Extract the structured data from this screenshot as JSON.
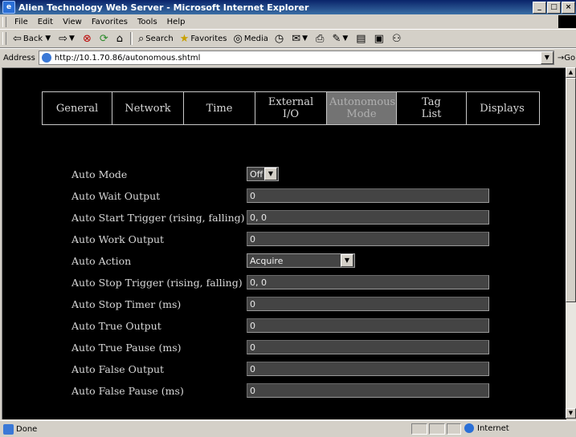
{
  "window": {
    "title": "Alien Technology Web Server - Microsoft Internet Explorer",
    "app_icon": "e",
    "minimize": "_",
    "maximize": "□",
    "close": "×"
  },
  "menu": [
    "File",
    "Edit",
    "View",
    "Favorites",
    "Tools",
    "Help"
  ],
  "toolbar": {
    "back": "Back",
    "search": "Search",
    "favorites": "Favorites",
    "media": "Media"
  },
  "address": {
    "label": "Address",
    "url": "http://10.1.70.86/autonomous.shtml",
    "go": "Go"
  },
  "nav": {
    "tabs": [
      {
        "label": "General",
        "active": false
      },
      {
        "label": "Network",
        "active": false
      },
      {
        "label": "Time",
        "active": false
      },
      {
        "label": "External I/O",
        "active": false
      },
      {
        "label": "Autonomous Mode",
        "active": true
      },
      {
        "label": "Tag List",
        "active": false
      },
      {
        "label": "Displays",
        "active": false
      }
    ]
  },
  "form": {
    "auto_mode": {
      "label": "Auto Mode",
      "value": "Off"
    },
    "auto_wait_output": {
      "label": "Auto Wait Output",
      "value": "0"
    },
    "auto_start_trigger": {
      "label": "Auto Start Trigger (rising, falling)",
      "value": "0, 0"
    },
    "auto_work_output": {
      "label": "Auto Work Output",
      "value": "0"
    },
    "auto_action": {
      "label": "Auto Action",
      "value": "Acquire"
    },
    "auto_stop_trigger": {
      "label": "Auto Stop Trigger (rising, falling)",
      "value": "0, 0"
    },
    "auto_stop_timer": {
      "label": "Auto Stop Timer (ms)",
      "value": "0"
    },
    "auto_true_output": {
      "label": "Auto True Output",
      "value": "0"
    },
    "auto_true_pause": {
      "label": "Auto True Pause (ms)",
      "value": "0"
    },
    "auto_false_output": {
      "label": "Auto False Output",
      "value": "0"
    },
    "auto_false_pause": {
      "label": "Auto False Pause (ms)",
      "value": "0"
    }
  },
  "status": {
    "text": "Done",
    "zone": "Internet"
  },
  "colors": {
    "page_bg": "#000000",
    "active_tab": "#737373",
    "field_bg": "#444444",
    "text": "#d8d8d8"
  }
}
